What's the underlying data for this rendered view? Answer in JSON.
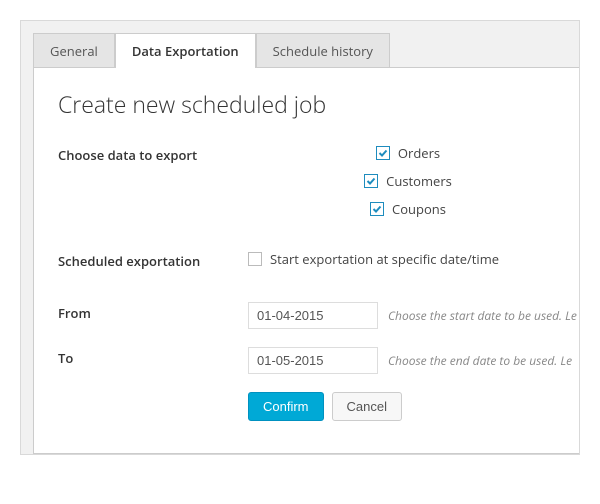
{
  "tabs": {
    "general": "General",
    "data_exportation": "Data Exportation",
    "schedule_history": "Schedule history"
  },
  "heading": "Create new scheduled job",
  "labels": {
    "choose_data": "Choose data to export",
    "scheduled_exportation": "Scheduled exportation",
    "from": "From",
    "to": "To"
  },
  "checkboxes": {
    "orders": "Orders",
    "customers": "Customers",
    "coupons": "Coupons",
    "start_specific": "Start exportation at specific date/time"
  },
  "inputs": {
    "from_value": "01-04-2015",
    "to_value": "01-05-2015"
  },
  "hints": {
    "from": "Choose the start date to be used. Le",
    "to": "Choose the end date to be used. Le"
  },
  "buttons": {
    "confirm": "Confirm",
    "cancel": "Cancel"
  }
}
